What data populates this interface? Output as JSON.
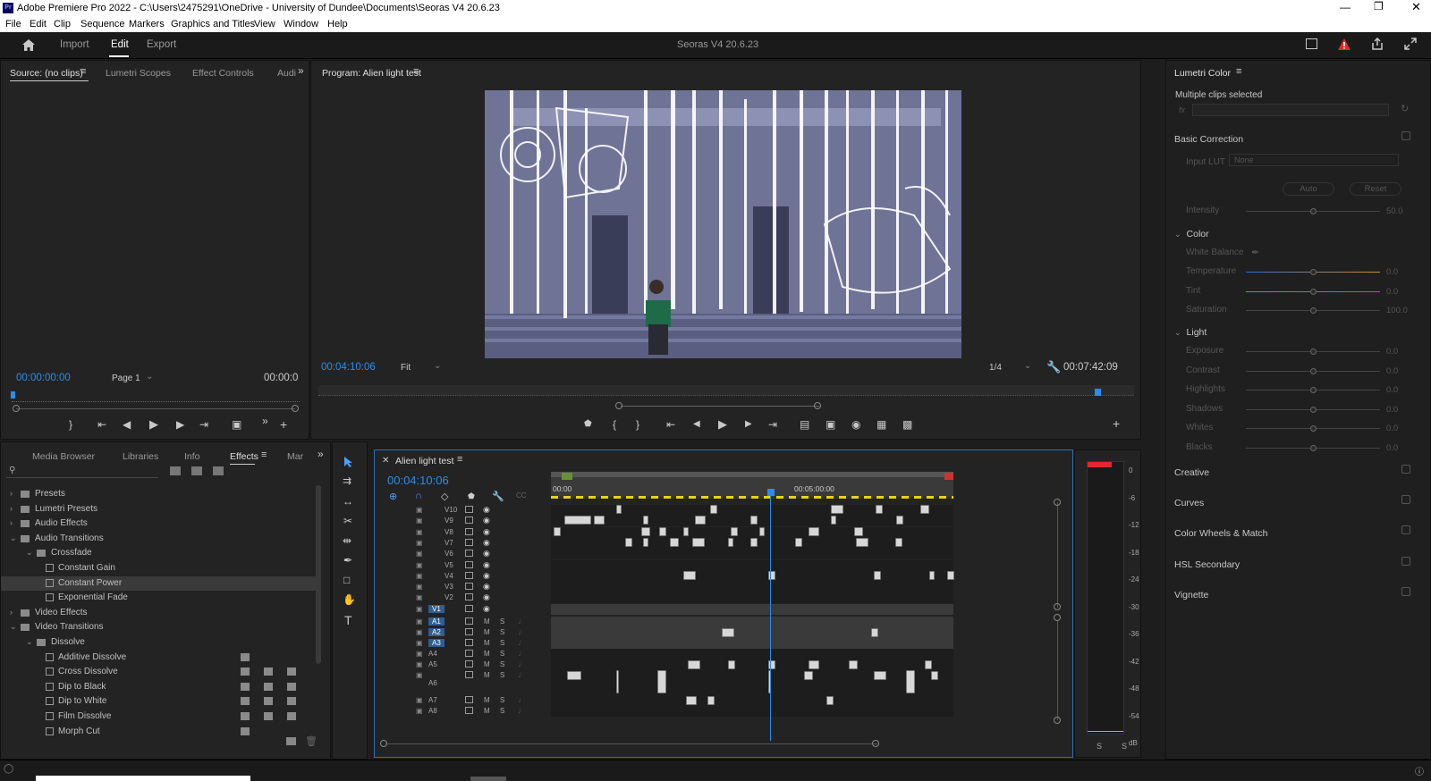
{
  "window": {
    "title": "Adobe Premiere Pro 2022 - C:\\Users\\2475291\\OneDrive - University of Dundee\\Documents\\Seoras V4 20.6.23",
    "app_icon": "Pr"
  },
  "menu": [
    "File",
    "Edit",
    "Clip",
    "Sequence",
    "Markers",
    "Graphics and Titles",
    "View",
    "Window",
    "Help"
  ],
  "header": {
    "tabs": [
      "Import",
      "Edit",
      "Export"
    ],
    "active_tab": "Edit",
    "project_title": "Seoras V4 20.6.23"
  },
  "source_panel": {
    "tabs": [
      "Source: (no clips)",
      "Lumetri Scopes",
      "Effect Controls",
      "Audi"
    ],
    "timecode_left": "00:00:00:00",
    "page": "Page 1",
    "timecode_right": "00:00:0"
  },
  "program_panel": {
    "title": "Program: Alien light test",
    "timecode_left": "00:04:10:06",
    "fit": "Fit",
    "resolution": "1/4",
    "timecode_right": "00:07:42:09"
  },
  "project_panel": {
    "tabs": [
      "Media Browser",
      "Libraries",
      "Info",
      "Effects",
      "Mar"
    ],
    "active_tab": "Effects",
    "tree": [
      {
        "label": "Presets",
        "level": 0,
        "type": "folder"
      },
      {
        "label": "Lumetri Presets",
        "level": 0,
        "type": "folder"
      },
      {
        "label": "Audio Effects",
        "level": 0,
        "type": "folder"
      },
      {
        "label": "Audio Transitions",
        "level": 0,
        "type": "folder",
        "open": true
      },
      {
        "label": "Crossfade",
        "level": 1,
        "type": "folder",
        "open": true
      },
      {
        "label": "Constant Gain",
        "level": 2,
        "type": "fx"
      },
      {
        "label": "Constant Power",
        "level": 2,
        "type": "fx",
        "selected": true
      },
      {
        "label": "Exponential Fade",
        "level": 2,
        "type": "fx"
      },
      {
        "label": "Video Effects",
        "level": 0,
        "type": "folder"
      },
      {
        "label": "Video Transitions",
        "level": 0,
        "type": "folder",
        "open": true
      },
      {
        "label": "Dissolve",
        "level": 1,
        "type": "folder",
        "open": true
      },
      {
        "label": "Additive Dissolve",
        "level": 2,
        "type": "fx",
        "badges": 1
      },
      {
        "label": "Cross Dissolve",
        "level": 2,
        "type": "fx",
        "badges": 3
      },
      {
        "label": "Dip to Black",
        "level": 2,
        "type": "fx",
        "badges": 3
      },
      {
        "label": "Dip to White",
        "level": 2,
        "type": "fx",
        "badges": 3
      },
      {
        "label": "Film Dissolve",
        "level": 2,
        "type": "fx",
        "badges": 3
      },
      {
        "label": "Morph Cut",
        "level": 2,
        "type": "fx",
        "badges": 1
      }
    ]
  },
  "timeline": {
    "sequence_name": "Alien light test",
    "timecode": "00:04:10:06",
    "ruler": [
      "00:00",
      "00:05:00:00"
    ],
    "video_tracks": [
      "V10",
      "V9",
      "V8",
      "V7",
      "V6",
      "V5",
      "V4",
      "V3",
      "V2",
      "V1"
    ],
    "audio_tracks": [
      "A1",
      "A2",
      "A3",
      "A4",
      "A5",
      "A6",
      "A7",
      "A8"
    ],
    "track_buttons": {
      "mute": "M",
      "solo": "S"
    }
  },
  "meter": {
    "scale": [
      "0",
      "-6",
      "-12",
      "-18",
      "-24",
      "-30",
      "-36",
      "-42",
      "-48",
      "-54",
      "dB"
    ],
    "buttons": [
      "S",
      "S"
    ]
  },
  "lumetri": {
    "title": "Lumetri Color",
    "subtitle": "Multiple clips selected",
    "fx_label": "fx",
    "basic_correction": "Basic Correction",
    "input_lut_label": "Input LUT",
    "input_lut_value": "None",
    "auto": "Auto",
    "reset": "Reset",
    "intensity": {
      "label": "Intensity",
      "value": "50.0"
    },
    "color_header": "Color",
    "white_balance": "White Balance",
    "color_sliders": [
      {
        "label": "Temperature",
        "value": "0.0"
      },
      {
        "label": "Tint",
        "value": "0.0"
      },
      {
        "label": "Saturation",
        "value": "100.0"
      }
    ],
    "light_header": "Light",
    "light_sliders": [
      {
        "label": "Exposure",
        "value": "0.0"
      },
      {
        "label": "Contrast",
        "value": "0.0"
      },
      {
        "label": "Highlights",
        "value": "0.0"
      },
      {
        "label": "Shadows",
        "value": "0.0"
      },
      {
        "label": "Whites",
        "value": "0.0"
      },
      {
        "label": "Blacks",
        "value": "0.0"
      }
    ],
    "sections": [
      "Creative",
      "Curves",
      "Color Wheels & Match",
      "HSL Secondary",
      "Vignette"
    ]
  },
  "colors": {
    "accent": "#2d8ceb",
    "panel": "#232323",
    "bg": "#1d1d1d",
    "warning": "#e0282d"
  }
}
